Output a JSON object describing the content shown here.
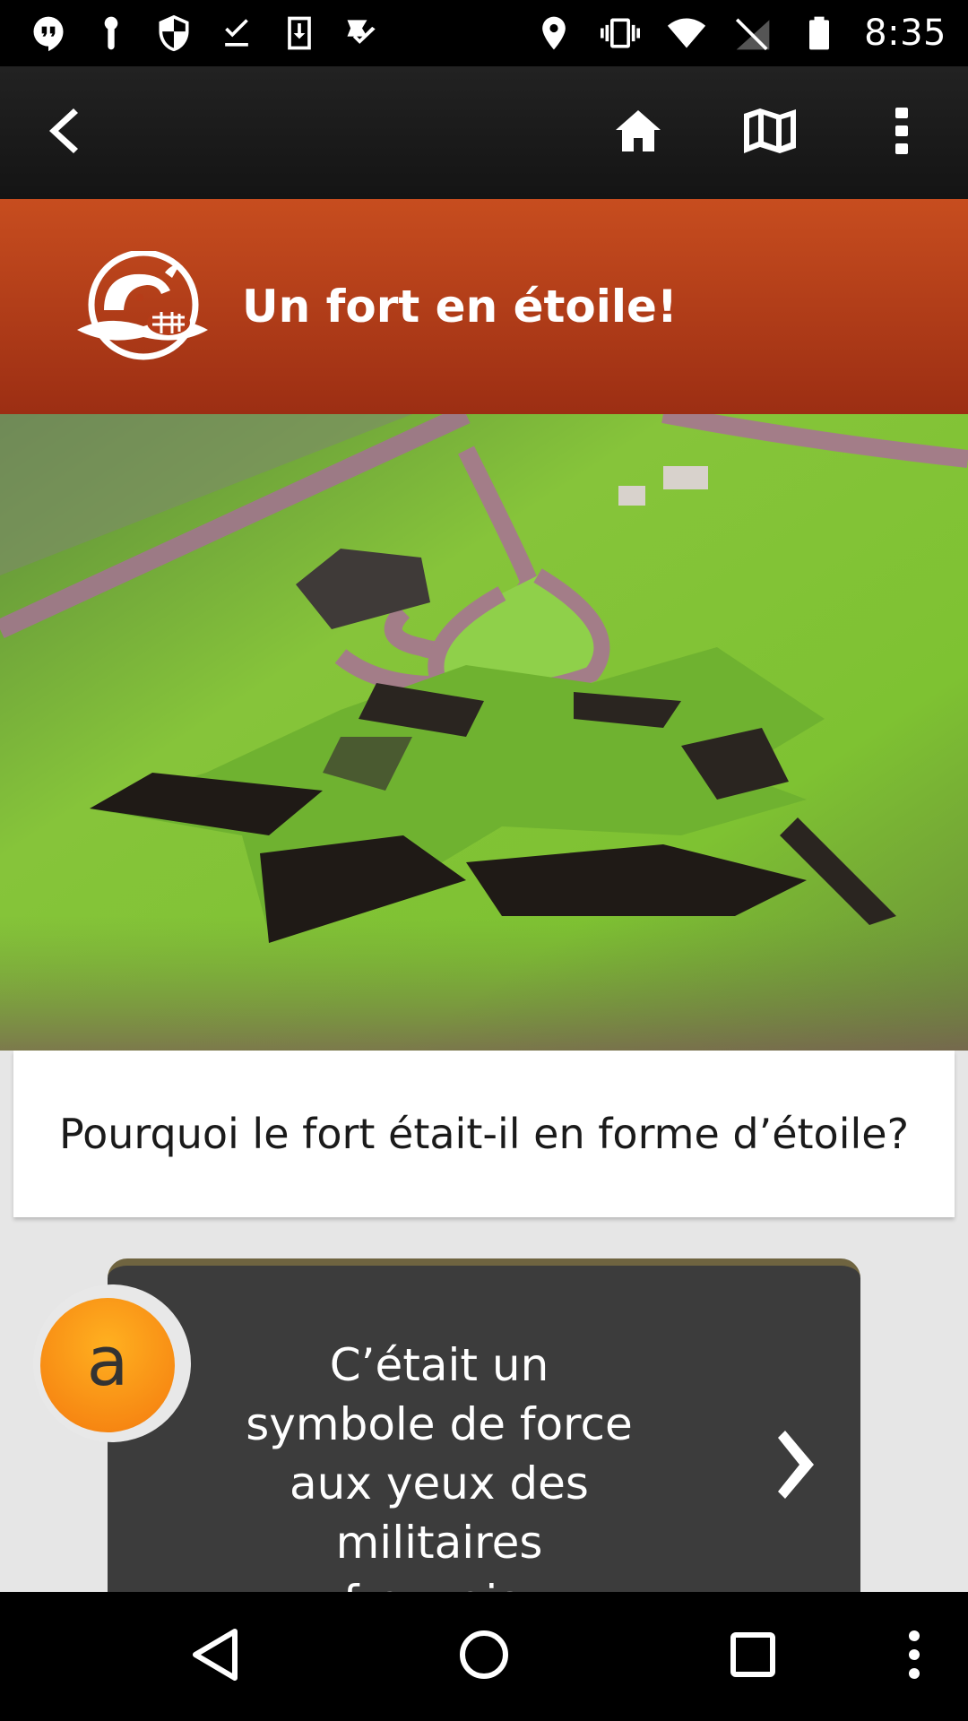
{
  "status_bar": {
    "time": "8:35",
    "left_icons": [
      "hangouts-icon",
      "keyhole-icon",
      "shield-icon",
      "download-done-icon",
      "download-icon",
      "task-check-icon"
    ],
    "right_icons": [
      "location-pin-icon",
      "vibrate-icon",
      "wifi-icon",
      "no-signal-icon",
      "battery-icon"
    ]
  },
  "app_bar": {
    "back": "back-arrow-icon",
    "home": "home-icon",
    "map": "map-icon",
    "menu": "overflow-menu-icon"
  },
  "header": {
    "logo": "beaver-logo-icon",
    "title": "Un fort en étoile!"
  },
  "photo": {
    "subject": "aerial-photo-star-fort"
  },
  "question": {
    "text": "Pourquoi le fort était-il en forme d’étoile?"
  },
  "answer": {
    "badge_letter": "a",
    "text": "C’était un symbole de force aux yeux des militaires français.",
    "next_icon": "chevron-right-icon"
  },
  "nav_bar": {
    "back": "nav-back-icon",
    "home": "nav-home-icon",
    "recents": "nav-recents-icon",
    "menu": "nav-menu-icon"
  },
  "colors": {
    "banner": "#b63c18",
    "answer_card": "#3c3c3c",
    "badge": "#f7931a"
  }
}
